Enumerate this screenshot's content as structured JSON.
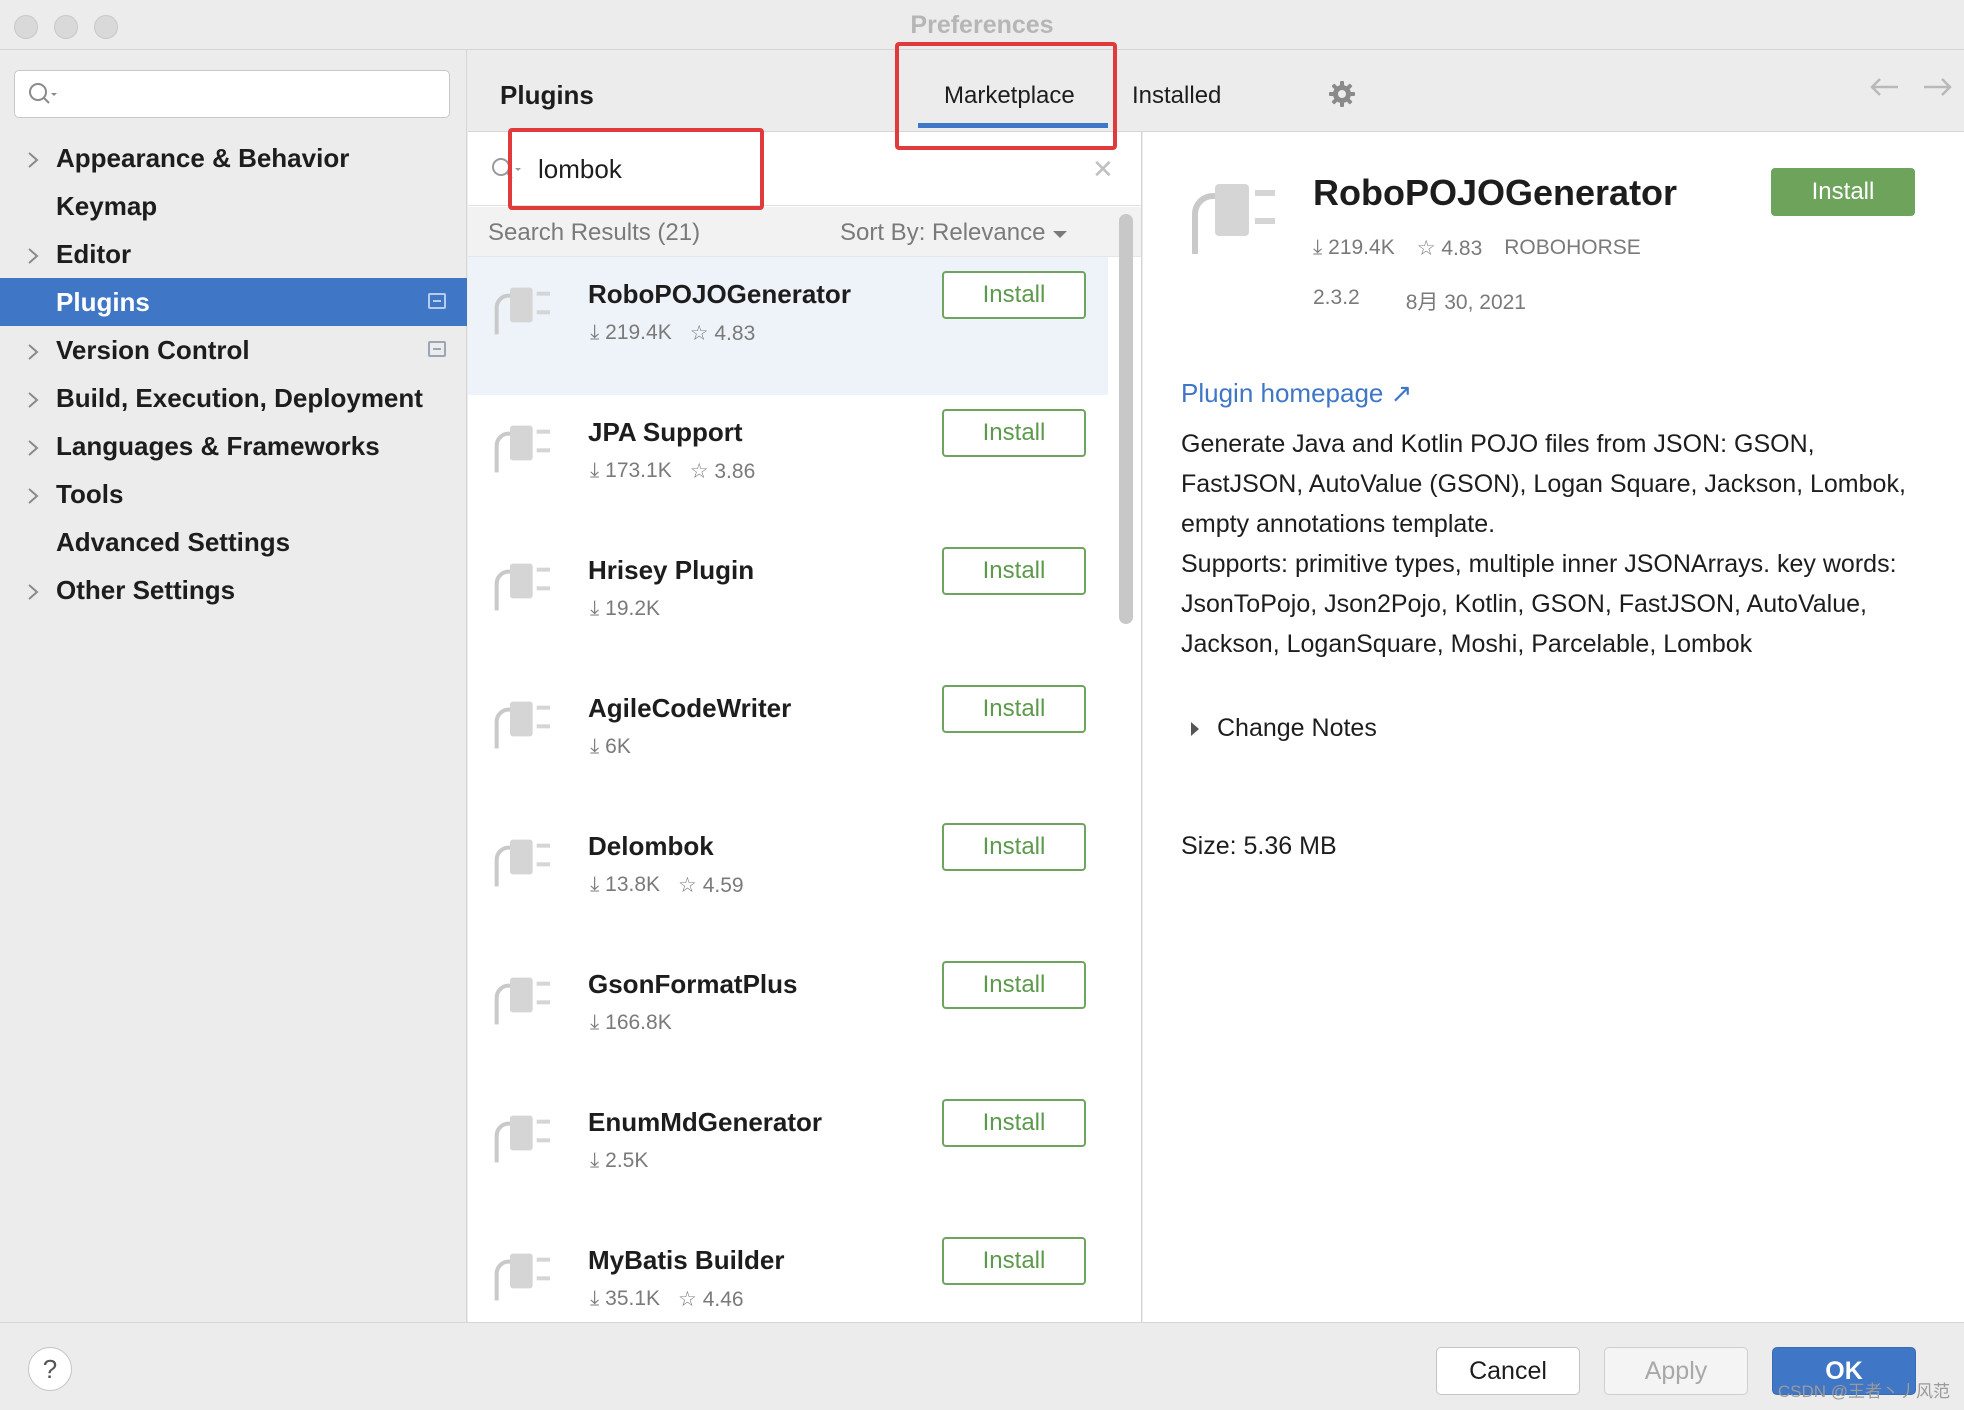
{
  "window": {
    "title": "Preferences"
  },
  "sidebar": {
    "search_placeholder": "",
    "items": [
      {
        "label": "Appearance & Behavior",
        "expandable": true,
        "selected": false,
        "badge": false
      },
      {
        "label": "Keymap",
        "expandable": false,
        "selected": false,
        "badge": false
      },
      {
        "label": "Editor",
        "expandable": true,
        "selected": false,
        "badge": false
      },
      {
        "label": "Plugins",
        "expandable": false,
        "selected": true,
        "badge": true
      },
      {
        "label": "Version Control",
        "expandable": true,
        "selected": false,
        "badge": true
      },
      {
        "label": "Build, Execution, Deployment",
        "expandable": true,
        "selected": false,
        "badge": false
      },
      {
        "label": "Languages & Frameworks",
        "expandable": true,
        "selected": false,
        "badge": false
      },
      {
        "label": "Tools",
        "expandable": true,
        "selected": false,
        "badge": false
      },
      {
        "label": "Advanced Settings",
        "expandable": false,
        "selected": false,
        "badge": false
      },
      {
        "label": "Other Settings",
        "expandable": true,
        "selected": false,
        "badge": false
      }
    ]
  },
  "header": {
    "title": "Plugins",
    "tabs": {
      "marketplace": "Marketplace",
      "installed": "Installed"
    },
    "active_tab": "Marketplace"
  },
  "search": {
    "value": "lombok",
    "results_label": "Search Results (21)",
    "sort_label": "Sort By: Relevance"
  },
  "plugins": [
    {
      "name": "RoboPOJOGenerator",
      "downloads": "219.4K",
      "rating": "4.83",
      "install_label": "Install",
      "selected": true
    },
    {
      "name": "JPA Support",
      "downloads": "173.1K",
      "rating": "3.86",
      "install_label": "Install",
      "selected": false
    },
    {
      "name": "Hrisey Plugin",
      "downloads": "19.2K",
      "rating": "",
      "install_label": "Install",
      "selected": false
    },
    {
      "name": "AgileCodeWriter",
      "downloads": "6K",
      "rating": "",
      "install_label": "Install",
      "selected": false
    },
    {
      "name": "Delombok",
      "downloads": "13.8K",
      "rating": "4.59",
      "install_label": "Install",
      "selected": false
    },
    {
      "name": "GsonFormatPlus",
      "downloads": "166.8K",
      "rating": "",
      "install_label": "Install",
      "selected": false
    },
    {
      "name": "EnumMdGenerator",
      "downloads": "2.5K",
      "rating": "",
      "install_label": "Install",
      "selected": false
    },
    {
      "name": "MyBatis Builder",
      "downloads": "35.1K",
      "rating": "4.46",
      "install_label": "Install",
      "selected": false
    }
  ],
  "detail": {
    "name": "RoboPOJOGenerator",
    "install_label": "Install",
    "downloads": "219.4K",
    "rating": "4.83",
    "vendor": "ROBOHORSE",
    "version": "2.3.2",
    "date": "8月 30, 2021",
    "homepage_label": "Plugin homepage ↗",
    "description": "Generate Java and Kotlin POJO files from JSON: GSON, FastJSON, AutoValue (GSON), Logan Square, Jackson, Lombok, empty annotations template.\nSupports: primitive types, multiple inner JSONArrays. key words: JsonToPojo, Json2Pojo, Kotlin, GSON, FastJSON, AutoValue, Jackson, LoganSquare, Moshi, Parcelable, Lombok",
    "change_notes_label": "Change Notes",
    "size_label": "Size: 5.36 MB"
  },
  "footer": {
    "help_label": "?",
    "cancel_label": "Cancel",
    "apply_label": "Apply",
    "ok_label": "OK",
    "watermark": "CSDN @王者丶丿风范"
  },
  "colors": {
    "selection": "#3f76c6",
    "install_green": "#6ea35c",
    "highlight_red": "#e03a3a",
    "link": "#3f76c6"
  }
}
